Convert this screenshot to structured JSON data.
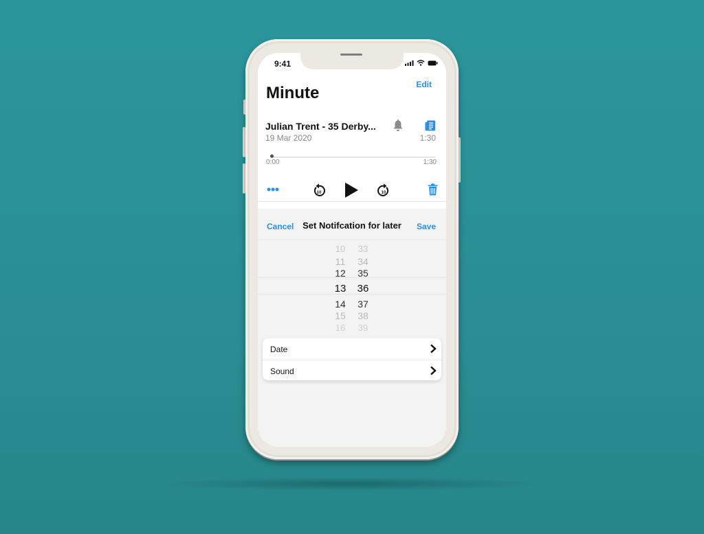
{
  "status_bar": {
    "time": "9:41"
  },
  "header": {
    "title": "Minute",
    "edit_label": "Edit"
  },
  "recording": {
    "title": "Julian Trent - 35 Derby...",
    "date": "19 Mar 2020",
    "duration": "1:30",
    "progress": 0,
    "time_start": "0:00",
    "time_end": "1:30"
  },
  "controls": {
    "more": "more-icon",
    "skip_back": "skip-back-10-icon",
    "play": "play-icon",
    "skip_forward": "skip-forward-10-icon",
    "delete": "trash-icon"
  },
  "sheet": {
    "cancel_label": "Cancel",
    "title": "Set Notifcation for later",
    "save_label": "Save"
  },
  "picker": {
    "hours": [
      "10",
      "11",
      "12",
      "13",
      "14",
      "15",
      "16"
    ],
    "minutes": [
      "33",
      "34",
      "35",
      "36",
      "37",
      "38",
      "39"
    ],
    "selected_hour": "13",
    "selected_minute": "36"
  },
  "options": [
    {
      "label": "Date"
    },
    {
      "label": "Sound"
    }
  ],
  "colors": {
    "accent": "#2e8fe6",
    "background": "#2a969c"
  }
}
